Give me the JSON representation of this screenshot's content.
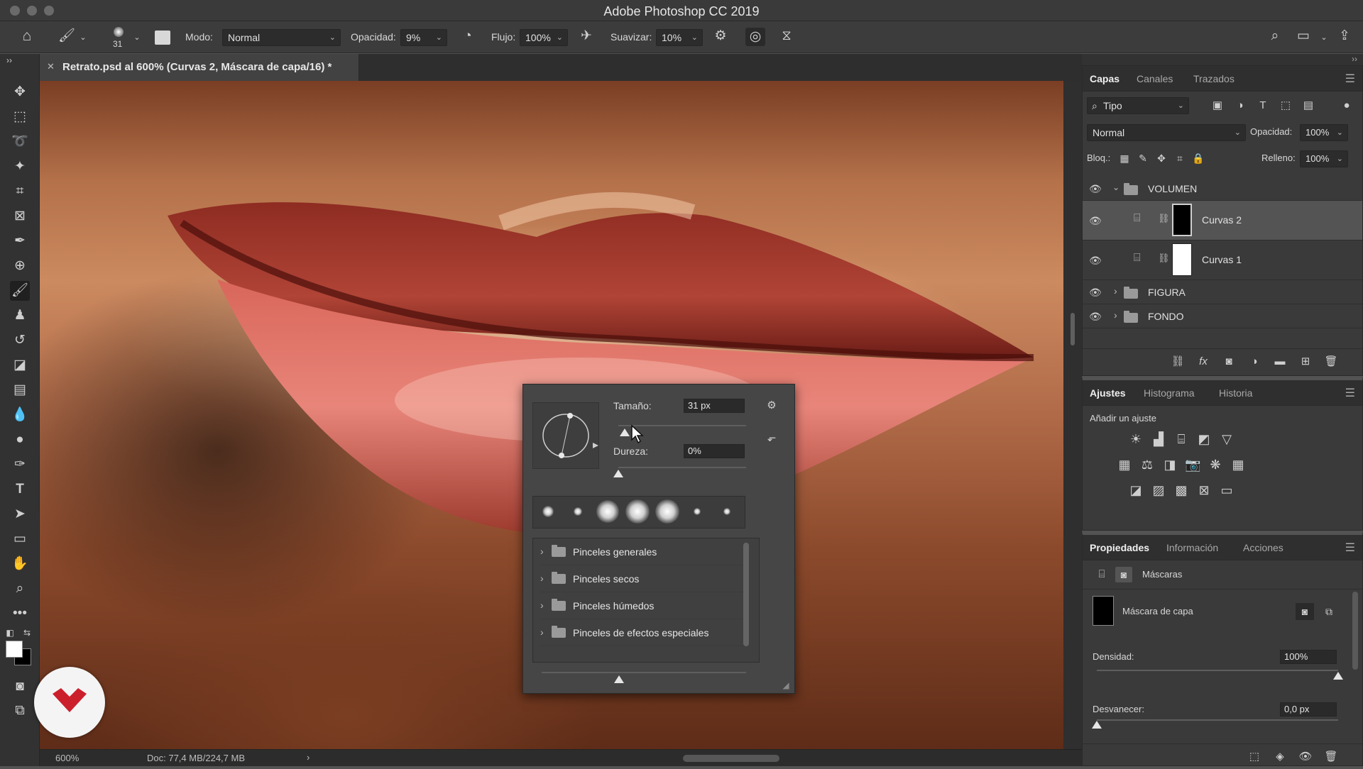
{
  "window": {
    "title": "Adobe Photoshop CC 2019"
  },
  "options_bar": {
    "brush_size": "31",
    "mode_label": "Modo:",
    "mode_value": "Normal",
    "opacity_label": "Opacidad:",
    "opacity_value": "9%",
    "flow_label": "Flujo:",
    "flow_value": "100%",
    "smoothing_label": "Suavizar:",
    "smoothing_value": "10%"
  },
  "document": {
    "tab_title": "Retrato.psd al 600% (Curvas 2, Máscara de capa/16) *",
    "zoom": "600%",
    "doc_info": "Doc: 77,4 MB/224,7 MB"
  },
  "brush_popup": {
    "size_label": "Tamaño:",
    "size_value": "31 px",
    "hardness_label": "Dureza:",
    "hardness_value": "0%",
    "size_fraction": 0.05,
    "hardness_fraction": 0.0,
    "folders": [
      "Pinceles generales",
      "Pinceles secos",
      "Pinceles húmedos",
      "Pinceles de efectos especiales"
    ]
  },
  "layers_panel": {
    "tabs": [
      "Capas",
      "Canales",
      "Trazados"
    ],
    "filter_value": "Tipo",
    "blend_value": "Normal",
    "opacity_label": "Opacidad:",
    "opacity_value": "100%",
    "lock_label": "Bloq.:",
    "fill_label": "Relleno:",
    "fill_value": "100%",
    "layers": [
      {
        "name": "VOLUMEN"
      },
      {
        "name": "Curvas 2"
      },
      {
        "name": "Curvas 1"
      },
      {
        "name": "FIGURA"
      },
      {
        "name": "FONDO"
      }
    ]
  },
  "adjustments_panel": {
    "tabs": [
      "Ajustes",
      "Histograma",
      "Historia"
    ],
    "add_label": "Añadir un ajuste"
  },
  "properties_panel": {
    "tabs": [
      "Propiedades",
      "Información",
      "Acciones"
    ],
    "section": "Máscaras",
    "mask_label": "Máscara de capa",
    "density_label": "Densidad:",
    "density_value": "100%",
    "feather_label": "Desvanecer:",
    "feather_value": "0,0 px",
    "density_fraction": 1.0,
    "feather_fraction": 0.0
  },
  "colors": {
    "accent": "#cc1f2c",
    "panel": "#3a3a3a"
  }
}
